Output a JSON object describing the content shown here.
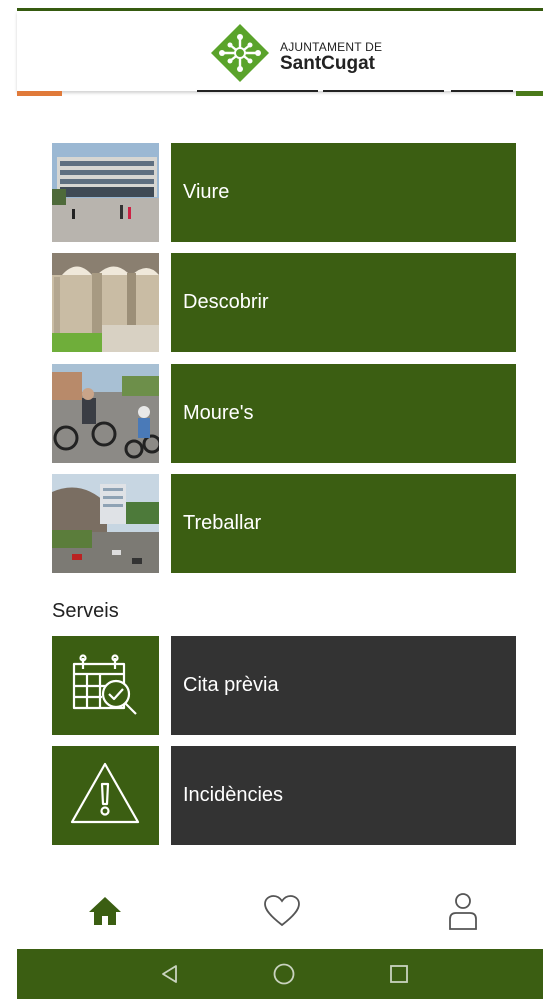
{
  "header": {
    "logo_line1": "AJUNTAMENT DE",
    "logo_line2": "SantCugat",
    "logo_icon": "sant-cugat-logo"
  },
  "colors": {
    "brand_green": "#3b5e12",
    "service_dark": "#333333",
    "accent_orange": "#e07a3a"
  },
  "main_tiles": [
    {
      "label": "Viure",
      "image": "city-hall-photo"
    },
    {
      "label": "Descobrir",
      "image": "cloister-photo"
    },
    {
      "label": "Moure's",
      "image": "cyclists-photo"
    },
    {
      "label": "Treballar",
      "image": "business-park-photo"
    }
  ],
  "services": {
    "title": "Serveis",
    "items": [
      {
        "label": "Cita prèvia",
        "icon": "calendar-check-icon"
      },
      {
        "label": "Incidències",
        "icon": "warning-icon"
      }
    ]
  },
  "bottom_nav": [
    {
      "icon": "home-icon",
      "active": true
    },
    {
      "icon": "heart-icon",
      "active": false
    },
    {
      "icon": "user-icon",
      "active": false
    }
  ],
  "system_nav": [
    {
      "icon": "back-icon"
    },
    {
      "icon": "home-circle-icon"
    },
    {
      "icon": "recents-icon"
    }
  ]
}
